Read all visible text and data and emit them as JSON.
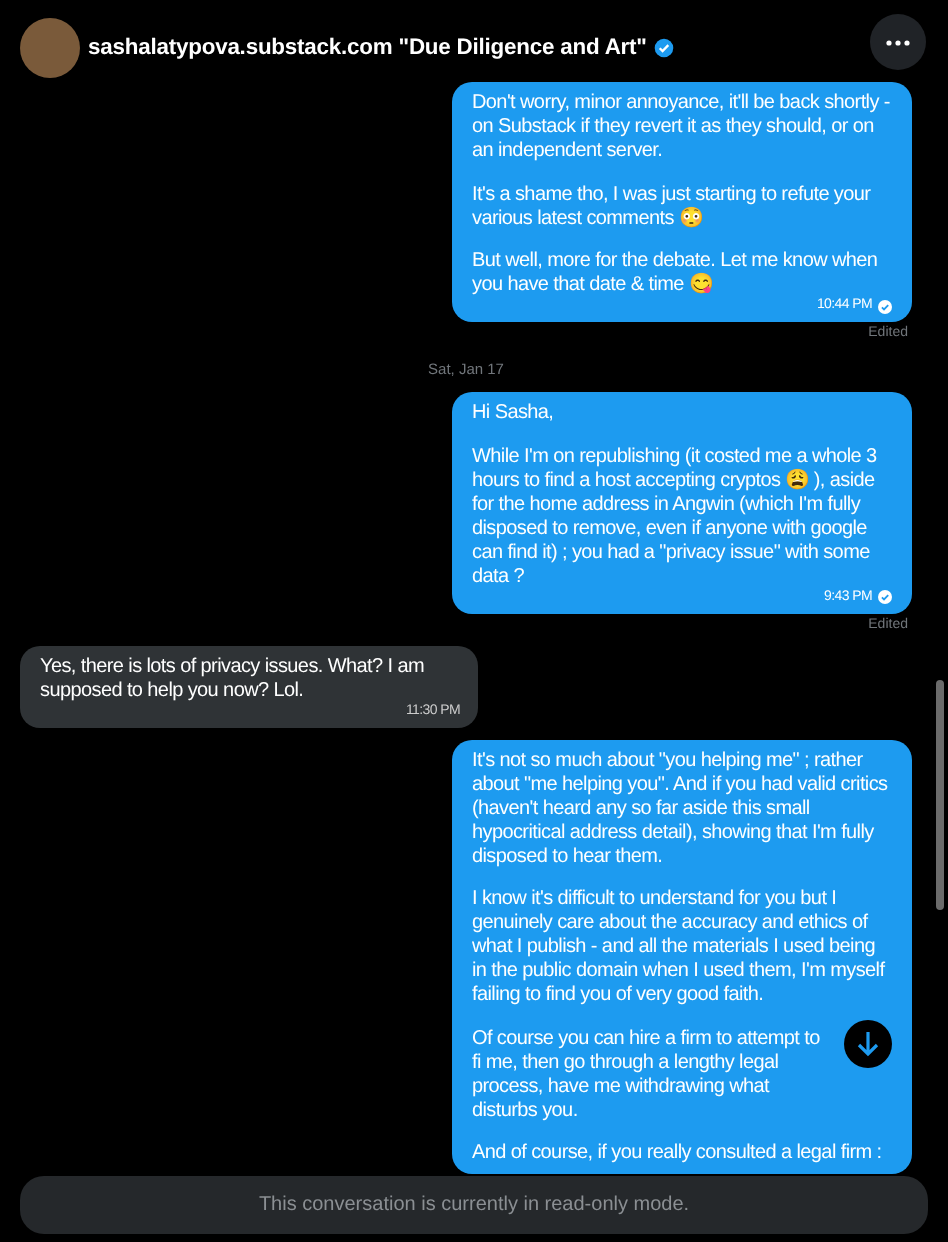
{
  "header": {
    "title": "sashalatypova.substack.com \"Due Diligence and Art\"",
    "verified": true
  },
  "messages": [
    {
      "kind": "sent",
      "paragraphs": [
        "Don't worry, minor annoyance, it'll be back shortly - on Substack if they revert it as they should, or on an independent server.",
        "It's a shame tho, I was just starting to refute your various latest comments 😳",
        "But well, more for the debate. Let me know when you have that date & time 😋"
      ],
      "time": "10:44 PM",
      "read": true,
      "edited": "Edited"
    },
    {
      "kind": "date",
      "label": "Sat, Jan 17"
    },
    {
      "kind": "sent",
      "paragraphs": [
        "Hi Sasha,",
        "While I'm on republishing (it costed me a whole 3 hours to find a host accepting cryptos 😩 ), aside for the home address in Angwin (which I'm fully disposed to remove, even if anyone with google can find it) ; you had a \"privacy issue\" with some data ?"
      ],
      "time": "9:43 PM",
      "read": true,
      "edited": "Edited"
    },
    {
      "kind": "received",
      "paragraphs": [
        "Yes, there is lots of privacy issues.  What? I am supposed to help you now?  Lol."
      ],
      "time": "11:30 PM"
    },
    {
      "kind": "sent",
      "paragraphs": [
        "It's not so much about \"you helping me\" ; rather about \"me helping you\". And if you had valid critics (haven't heard any so far aside this small hypocritical address detail), showing that I'm fully disposed to hear them.",
        "I know it's difficult to understand for you but I genuinely care about the accuracy and ethics of what I publish - and all the materials I used being in the public domain when I used them, I'm myself failing to find you of very good faith.",
        "Of course you can hire a firm to attempt to fi me, then go through a lengthy legal process, have me withdrawing what disturbs you.",
        "And of course, if you really consulted a legal firm :"
      ]
    }
  ],
  "notice": "This conversation is currently in read-only mode."
}
